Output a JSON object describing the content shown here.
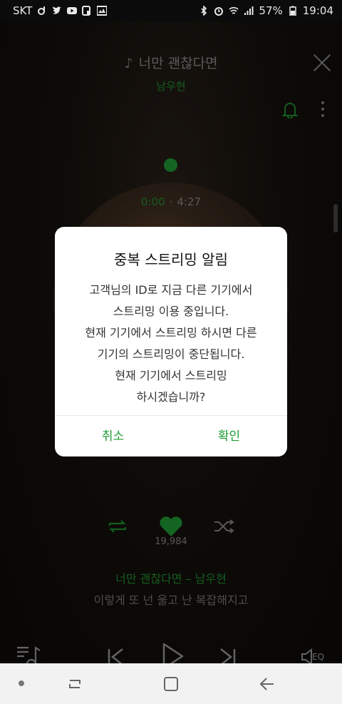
{
  "status_bar": {
    "carrier": "SKT",
    "battery": "57%",
    "time": "19:04",
    "left_icons": [
      "music-app-icon",
      "twitter-icon",
      "youtube-icon",
      "phone-icon",
      "gallery-icon"
    ],
    "right_icons": [
      "bluetooth-icon",
      "alarm-icon",
      "wifi-icon",
      "signal-icon",
      "battery-icon"
    ]
  },
  "player": {
    "song_title": "너만 괜찮다면",
    "artist": "남우현",
    "time_current": "0:00",
    "time_separator": "·",
    "time_total": "4:27",
    "likes": "19,984",
    "lyric_title_line": "너만 괜찮다면 – 남우현",
    "lyric_line": "이렇게 또 넌 울고 난 복잡해지고",
    "eq_label": "EQ",
    "accent_color": "#1f9b35"
  },
  "dialog": {
    "title": "중복 스트리밍 알림",
    "body_lines": [
      "고객님의 ID로 지금 다른 기기에서",
      "스트리밍 이용 중입니다.",
      "현재 기기에서 스트리밍 하시면 다른",
      "기기의 스트리밍이 중단됩니다.",
      "현재 기기에서 스트리밍",
      "하시겠습니까?"
    ],
    "cancel_label": "취소",
    "confirm_label": "확인"
  }
}
